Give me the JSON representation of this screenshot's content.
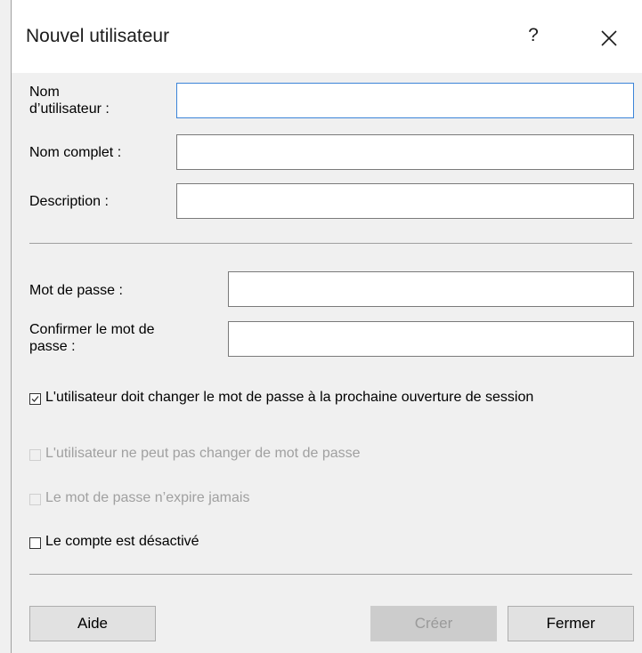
{
  "dialog": {
    "title": "Nouvel utilisateur",
    "help_label": "?"
  },
  "fields": {
    "username": {
      "label": "Nom\nd’utilisateur :",
      "value": ""
    },
    "fullname": {
      "label": "Nom complet :",
      "value": ""
    },
    "description": {
      "label": "Description :",
      "value": ""
    },
    "password": {
      "label": "Mot de passe :",
      "value": ""
    },
    "confirm": {
      "label": "Confirmer le mot de\npasse :",
      "value": ""
    }
  },
  "options": [
    {
      "label": "L'utilisateur doit changer le mot de passe à la prochaine ouverture de session",
      "checked": true,
      "enabled": true
    },
    {
      "label": "L'utilisateur ne peut pas changer de mot de passe",
      "checked": false,
      "enabled": false
    },
    {
      "label": "Le mot de passe n’expire jamais",
      "checked": false,
      "enabled": false
    },
    {
      "label": "Le compte est désactivé",
      "checked": false,
      "enabled": true
    }
  ],
  "buttons": {
    "help": "Aide",
    "create": "Créer",
    "close": "Fermer"
  },
  "icons": {
    "close": "close-icon",
    "check": "checkmark-icon"
  }
}
